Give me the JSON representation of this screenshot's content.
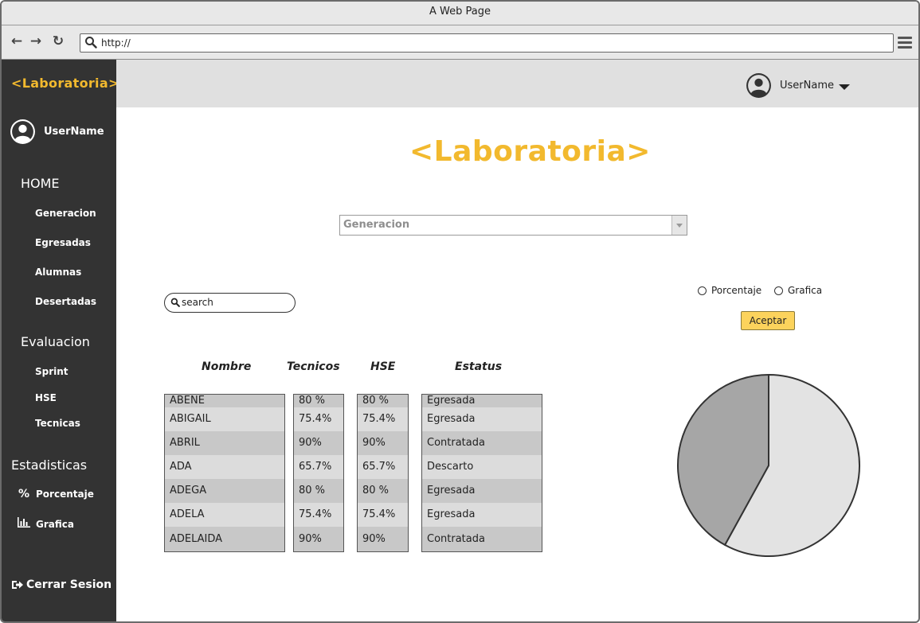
{
  "browser": {
    "title": "A Web Page",
    "url": "http://"
  },
  "sidebar": {
    "logo": "<Laboratoria>",
    "username": "UserName",
    "sections": [
      {
        "heading": "HOME",
        "items": [
          "Generacion",
          "Egresadas",
          "Alumnas",
          "Desertadas"
        ]
      },
      {
        "heading": "Evaluacion",
        "items": [
          "Sprint",
          "HSE",
          "Tecnicas"
        ]
      },
      {
        "heading": "Estadisticas",
        "items": [
          {
            "label": "Porcentaje",
            "icon": "percent-icon"
          },
          {
            "label": "Grafica",
            "icon": "bar-chart-icon"
          }
        ]
      }
    ],
    "logout": "Cerrar Sesion"
  },
  "header": {
    "username": "UserName"
  },
  "main": {
    "logo": "<Laboratoria>",
    "generation_select": "Generacion",
    "search_placeholder": "search",
    "options": [
      "Porcentaje",
      "Grafica"
    ],
    "accept_label": "Aceptar",
    "table": {
      "columns": [
        "Nombre",
        "Tecnicos",
        "HSE",
        "Estatus"
      ],
      "rows": [
        [
          "ABENE",
          "80 %",
          "80 %",
          "Egresada"
        ],
        [
          "ABIGAIL",
          "75.4%",
          "75.4%",
          "Egresada"
        ],
        [
          "ABRIL",
          "90%",
          "90%",
          "Contratada"
        ],
        [
          "ADA",
          "65.7%",
          "65.7%",
          "Descarto"
        ],
        [
          "ADEGA",
          "80 %",
          "80 %",
          "Egresada"
        ],
        [
          "ADELA",
          "75.4%",
          "75.4%",
          "Egresada"
        ],
        [
          "ADELAIDA",
          "90%",
          "90%",
          "Contratada"
        ]
      ]
    }
  },
  "chart_data": {
    "type": "pie",
    "values": [
      58,
      42
    ],
    "colors": [
      "#e3e3e3",
      "#a6a6a6"
    ]
  },
  "colors": {
    "brand": "#f2b92e",
    "sidebar_bg": "#333333",
    "accept_button": "#fcd35c"
  }
}
